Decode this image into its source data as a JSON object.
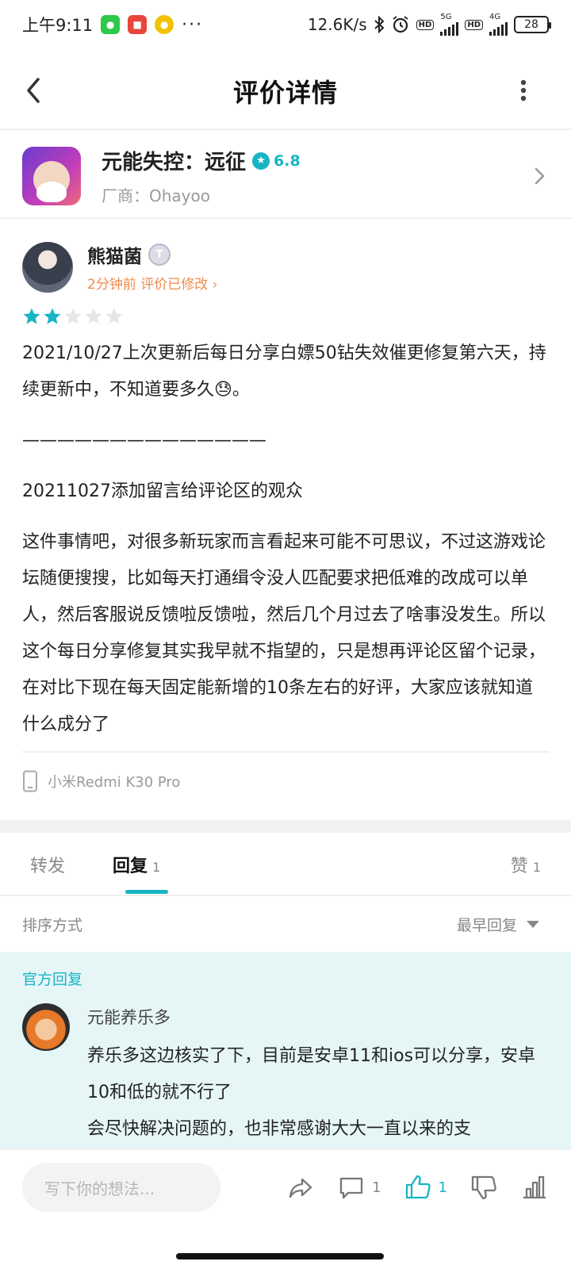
{
  "status_bar": {
    "time": "上午9:11",
    "speed": "12.6K/s",
    "hd": "HD",
    "net1": "5G",
    "net2": "4G",
    "battery": "28"
  },
  "header": {
    "title": "评价详情"
  },
  "game": {
    "name": "元能失控：远征",
    "score": "6.8",
    "vendor": "厂商：Ohayoo"
  },
  "review": {
    "username": "熊猫菌",
    "level_badge": "T",
    "meta": "2分钟前 评价已修改",
    "stars_filled": 2,
    "stars_total": 5,
    "paragraph1": "2021/10/27上次更新后每日分享白嫖50钻失效催更修复第六天，持续更新中，不知道要多久😓。",
    "divider": "——————————————",
    "paragraph2": "20211027添加留言给评论区的观众",
    "paragraph3": "这件事情吧，对很多新玩家而言看起来可能不可思议，不过这游戏论坛随便搜搜，比如每天打通缉令没人匹配要求把低难的改成可以单人，然后客服说反馈啦反馈啦，然后几个月过去了啥事没发生。所以这个每日分享修复其实我早就不指望的，只是想再评论区留个记录，在对比下现在每天固定能新增的10条左右的好评，大家应该就知道什么成分了",
    "device": "小米Redmi K30 Pro"
  },
  "tabs": {
    "forward": "转发",
    "reply": "回复",
    "reply_count": "1",
    "like": "赞",
    "like_count": "1"
  },
  "sort": {
    "label": "排序方式",
    "value": "最早回复"
  },
  "official_reply": {
    "title": "官方回复",
    "name": "元能养乐多",
    "text_line1": "养乐多这边核实了下，目前是安卓11和ios可以分享，安卓10和低的就不行了",
    "text_line2": "会尽快解决问题的，也非常感谢大大一直以来的支"
  },
  "bottom_bar": {
    "placeholder": "写下你的想法...",
    "comment_count": "1",
    "like_count": "1"
  },
  "colors": {
    "accent": "#17b5c4",
    "orange": "#f08a4b",
    "official_bg": "#e6f6f7"
  }
}
